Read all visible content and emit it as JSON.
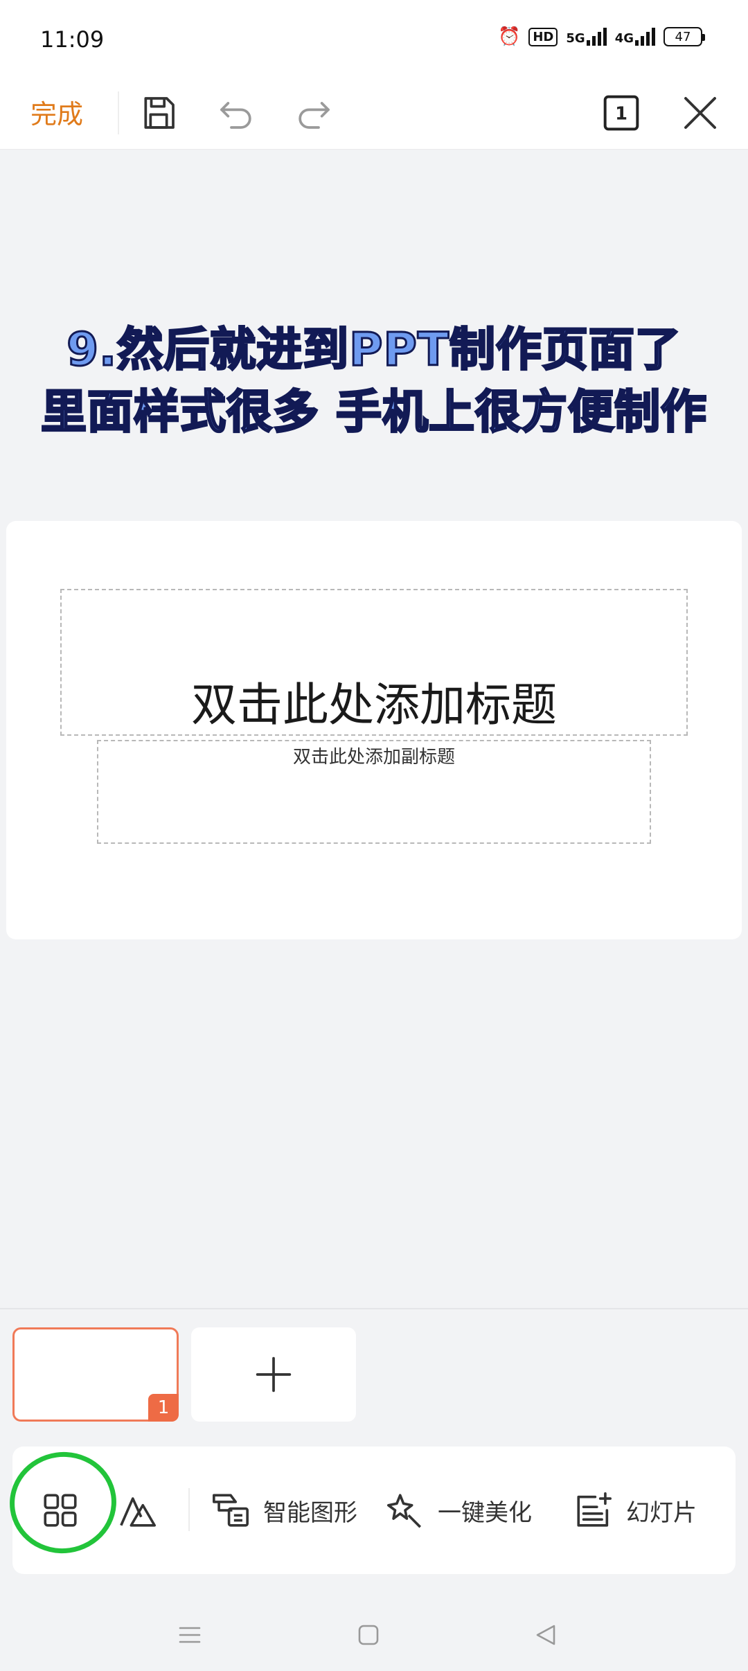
{
  "status_bar": {
    "time": "11:09",
    "hd_label": "HD",
    "signal_1": "5G",
    "signal_2": "4G",
    "battery": "47"
  },
  "toolbar": {
    "done_label": "完成",
    "page_count": "1"
  },
  "caption": {
    "line1": "9.然后就进到PPT制作页面了",
    "line2": "里面样式很多 手机上很方便制作"
  },
  "slide": {
    "title_placeholder": "双击此处添加标题",
    "subtitle_placeholder": "双击此处添加副标题"
  },
  "thumbnails": {
    "current_number": "1"
  },
  "bottom_bar": {
    "smart_shape_label": "智能图形",
    "beautify_label": "一键美化",
    "slide_label": "幻灯片"
  },
  "colors": {
    "accent_orange": "#e07b1b",
    "thumb_border": "#f07a58",
    "annotation_green": "#22c43a",
    "caption_fill": "#6f9bf0"
  }
}
